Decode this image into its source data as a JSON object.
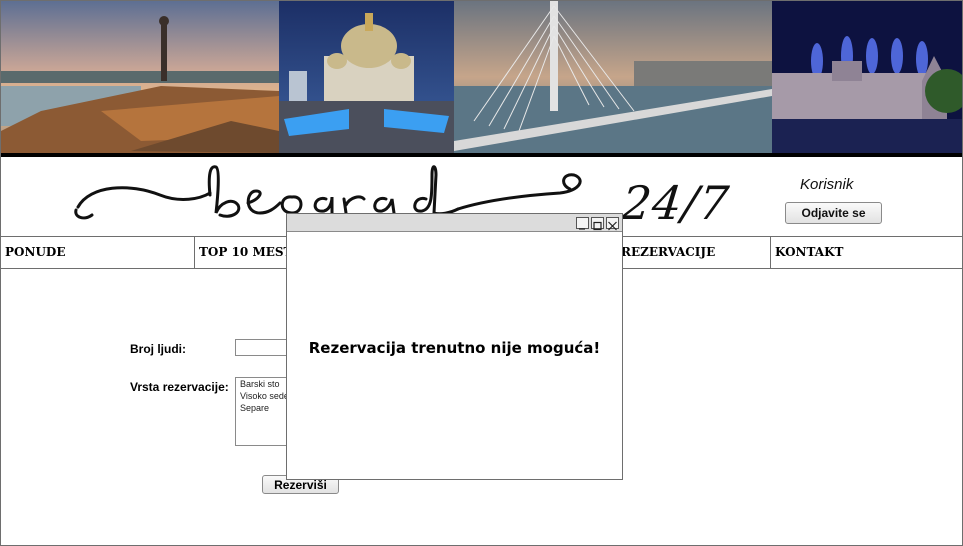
{
  "logo": {
    "script_text": "beograd",
    "number": "24/7"
  },
  "user": {
    "name": "Korisnik",
    "logout_label": "Odjavite se"
  },
  "nav": {
    "items": [
      {
        "label": "PONUDE"
      },
      {
        "label": "TOP 10 MESTA"
      },
      {
        "label": ""
      },
      {
        "label": "REZERVACIJE"
      },
      {
        "label": "KONTAKT"
      }
    ]
  },
  "form": {
    "people_label": "Broj ljudi:",
    "people_value": "",
    "type_label": "Vrsta rezervacije:",
    "type_options": [
      "Barski sto",
      "Visoko sedenje",
      "Separe"
    ],
    "submit_label": "Rezerviši"
  },
  "dialog": {
    "message": "Rezervacija trenutno nije moguća!",
    "controls": [
      "minimize-icon",
      "maximize-icon",
      "close-icon"
    ]
  },
  "banner": {
    "photos": [
      "fortress-statue-sunset",
      "cathedral-night",
      "cable-bridge-river",
      "fortress-fireworks"
    ]
  }
}
